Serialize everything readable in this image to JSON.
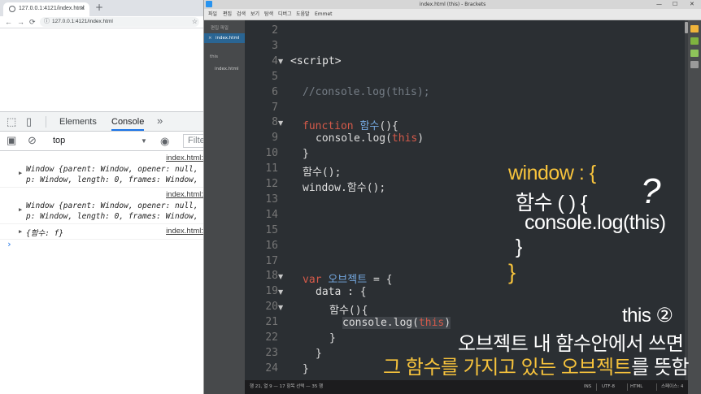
{
  "browser": {
    "tab_title": "127.0.0.1:4121/index.html",
    "tab_close": "×",
    "new_tab": "+",
    "url": "127.0.0.1:4121/index.html",
    "devtools": {
      "tabs": [
        "Elements",
        "Console"
      ],
      "active_tab": "Console",
      "more": "»",
      "context": "top",
      "filter_placeholder": "Filte",
      "messages": [
        {
          "source": "index.html:",
          "lines": [
            "Window {parent: Window, opener: null,",
            "p: Window, length: 0, frames: Window,"
          ]
        },
        {
          "source": "index.html:",
          "lines": [
            "Window {parent: Window, opener: null,",
            "p: Window, length: 0, frames: Window,"
          ]
        },
        {
          "source": "index.html:",
          "lines": [
            "{함수: f}"
          ]
        }
      ],
      "prompt": "›"
    }
  },
  "brackets": {
    "title": "index.html (this) - Brackets",
    "menu": [
      "파일",
      "편집",
      "검색",
      "보기",
      "탐색",
      "디버그",
      "도움말",
      "Emmet"
    ],
    "sidebar": {
      "working_files_header": "편집 파일",
      "active_file": "index.html",
      "project": "this",
      "project_file": "index.html"
    },
    "line_numbers": [
      "2",
      "3",
      "4",
      "5",
      "6",
      "7",
      "8",
      "9",
      "10",
      "11",
      "12",
      "13",
      "14",
      "15",
      "16",
      "17",
      "18",
      "19",
      "20",
      "21",
      "22",
      "23",
      "24"
    ],
    "code": {
      "l4": "<script>",
      "l6": "//console.log(this);",
      "l8_kw": "function",
      "l8_name": "함수",
      "l8_rest": "(){",
      "l9_a": "console.log(",
      "l9_this": "this",
      "l9_b": ")",
      "l10": "}",
      "l11": "함수();",
      "l12": "window.함수();",
      "l18_kw": "var",
      "l18_name": "오브젝트",
      "l18_rest": " = {",
      "l19": "data : {",
      "l20": "함수(){",
      "l21_a": "console.log(",
      "l21_this": "this",
      "l21_b": ")",
      "l22": "}",
      "l23": "}",
      "l24": "}"
    },
    "status": {
      "position": "행 21, 열 9 — 17 항목 선택 — 35 행",
      "ins": "INS",
      "encoding": "UTF-8",
      "mode": "HTML",
      "spaces": "스페이스: 4"
    }
  },
  "overlay": {
    "window_open": "window : {",
    "fn_open": "함수 ( ) {",
    "question": "?",
    "console_line": "console.log(this)",
    "brace_inner": "}",
    "brace_outer": "}",
    "caption_1": "this ②",
    "caption_2": "오브젝트 내 함수안에서 쓰면",
    "caption_3_yellow": "그 함수를 가지고 있는 오브젝트",
    "caption_3_white": "를 뜻함"
  },
  "colors": {
    "accent_yellow": "#f7c33c",
    "keyword_red": "#d55a4a",
    "identifier_blue": "#74a8e0",
    "devtools_blue": "#1a73e8"
  }
}
